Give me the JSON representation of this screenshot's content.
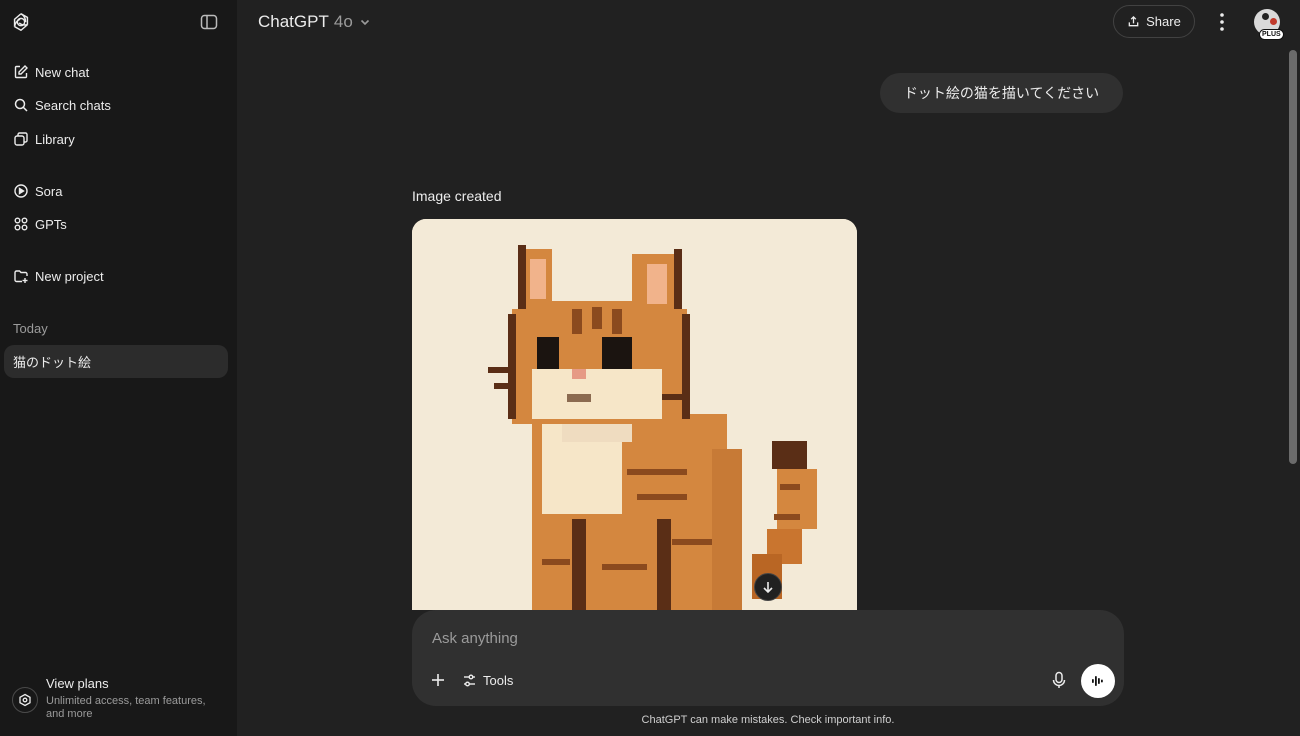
{
  "sidebar": {
    "nav": [
      {
        "label": "New chat",
        "icon": "new-chat-icon"
      },
      {
        "label": "Search chats",
        "icon": "search-icon"
      },
      {
        "label": "Library",
        "icon": "library-icon"
      },
      {
        "label": "Sora",
        "icon": "play-circle-icon"
      },
      {
        "label": "GPTs",
        "icon": "grid-icon"
      },
      {
        "label": "New project",
        "icon": "folder-plus-icon"
      }
    ],
    "section_today": "Today",
    "chats": [
      {
        "title": "猫のドット絵"
      }
    ],
    "plans": {
      "title": "View plans",
      "subtitle": "Unlimited access, team features, and more"
    }
  },
  "header": {
    "title": "ChatGPT",
    "model": "4o",
    "share_label": "Share",
    "badge": "PLUS"
  },
  "conversation": {
    "user_message": "ドット絵の猫を描いてください",
    "assistant_label": "Image created"
  },
  "composer": {
    "placeholder": "Ask anything",
    "tools_label": "Tools"
  },
  "footer": {
    "disclaimer": "ChatGPT can make mistakes. Check important info."
  },
  "colors": {
    "background": "#212121",
    "sidebar": "#181818",
    "bubble": "#303030",
    "image_bg": "#f3ead7",
    "cat_orange": "#d4873f",
    "cat_dark": "#5a2e16",
    "cat_cream": "#f6e6c8"
  }
}
